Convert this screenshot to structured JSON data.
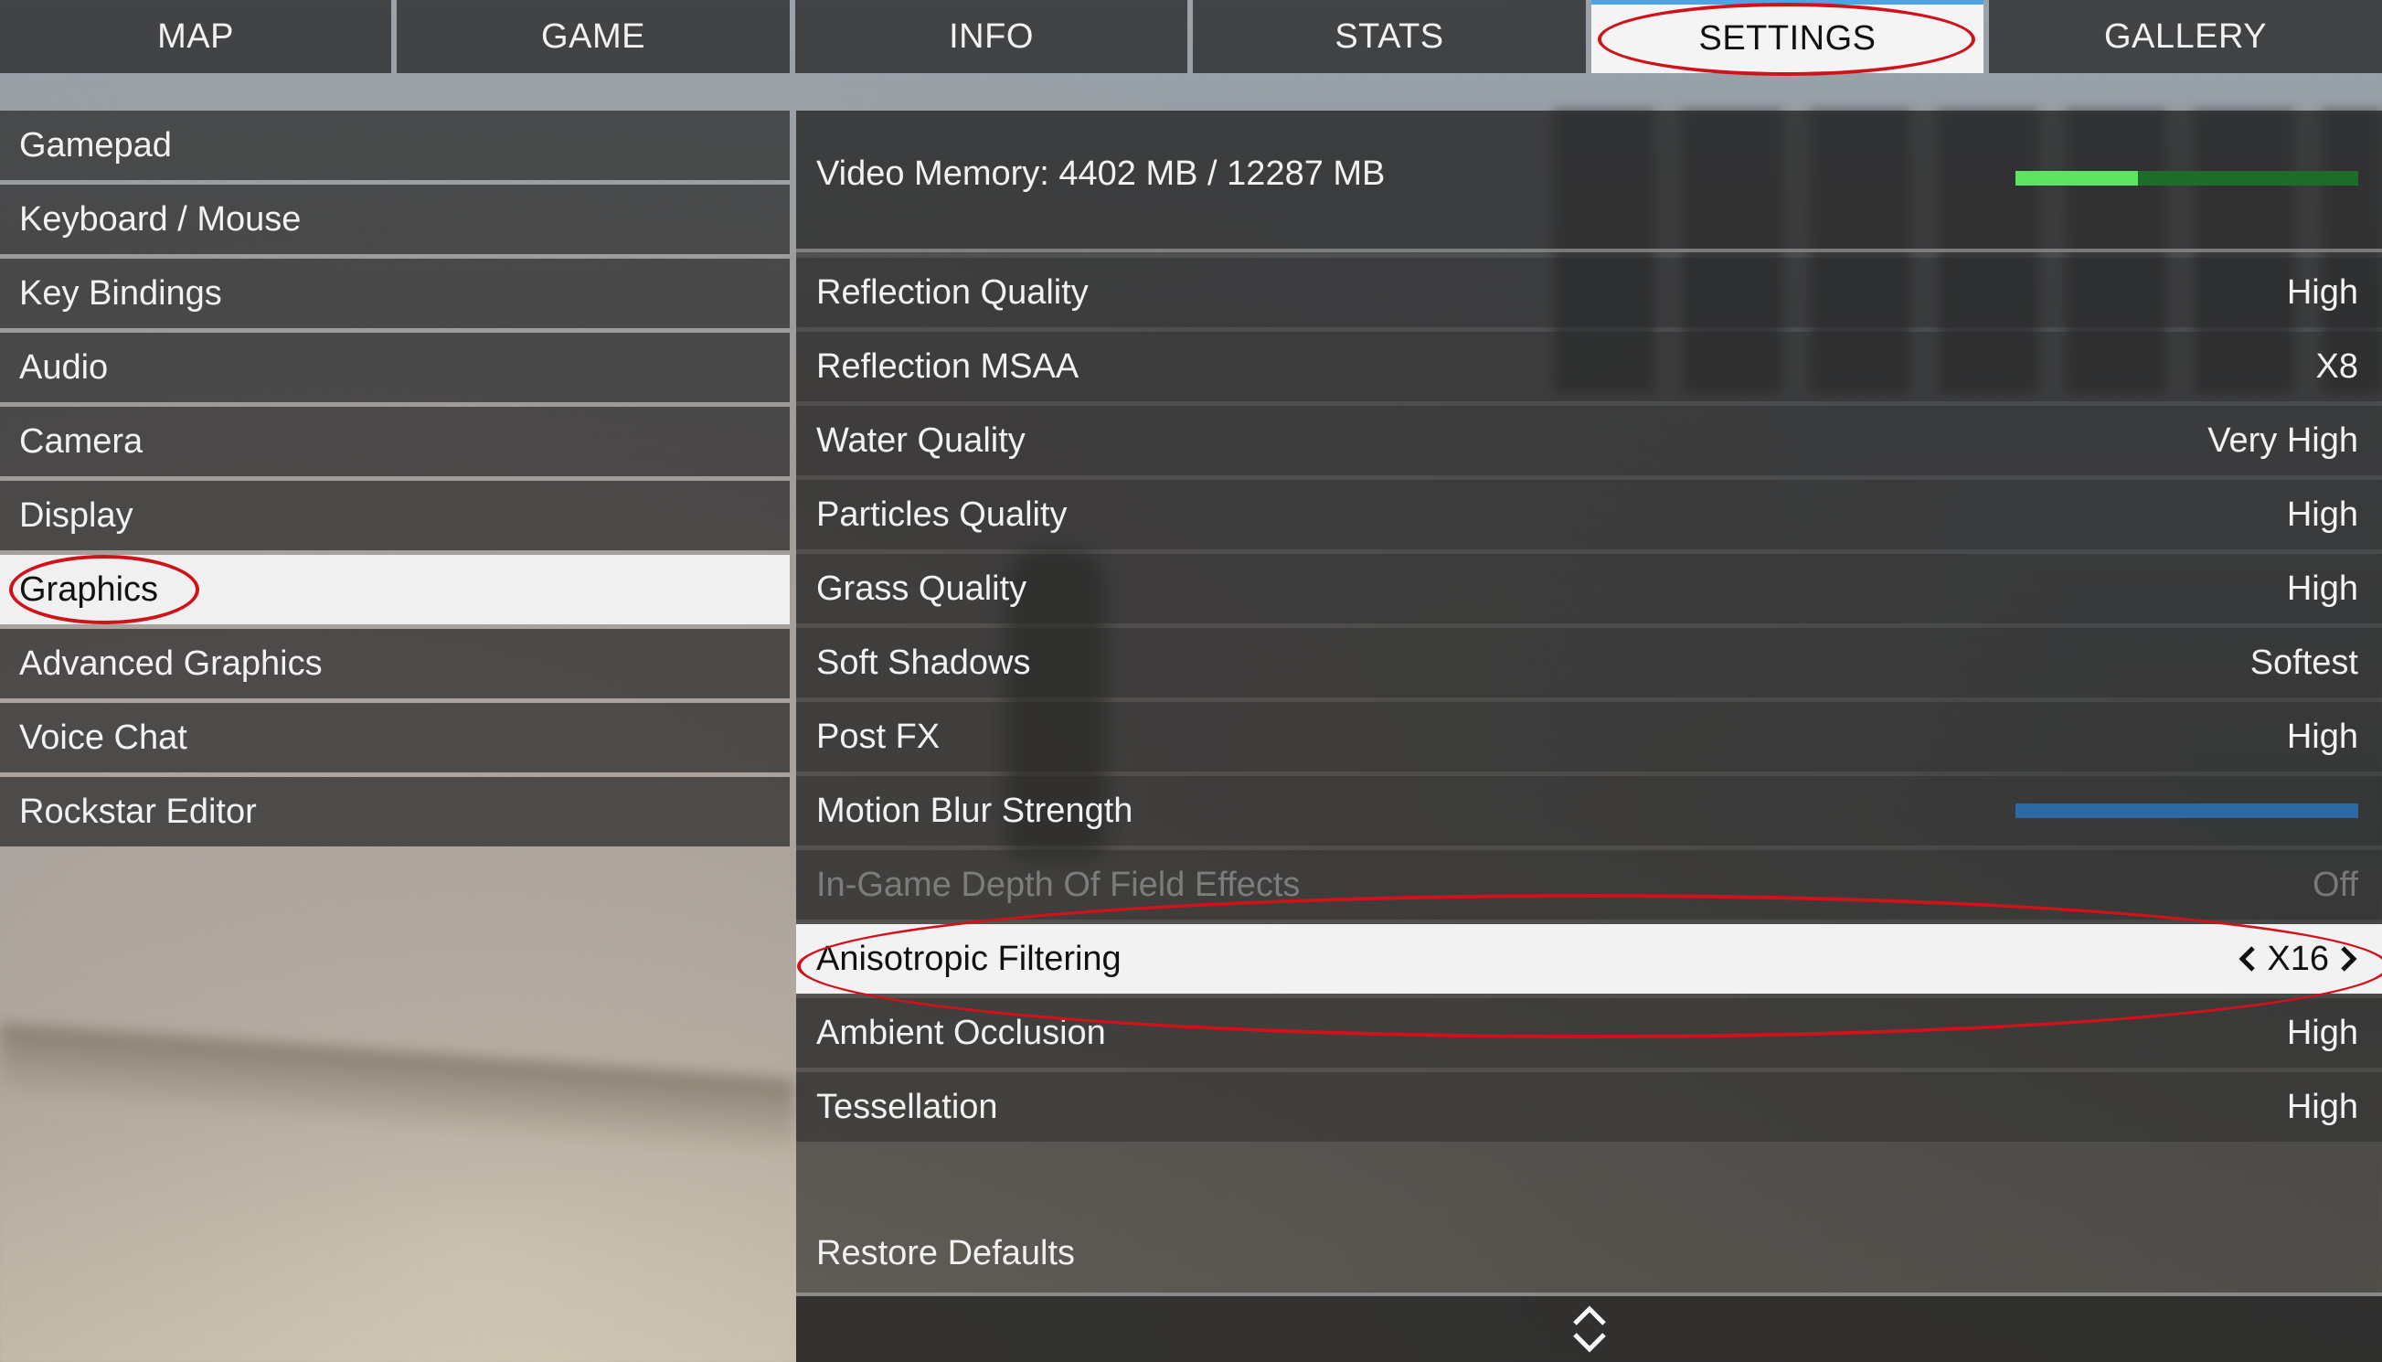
{
  "tabs": [
    {
      "label": "MAP"
    },
    {
      "label": "GAME"
    },
    {
      "label": "INFO"
    },
    {
      "label": "STATS"
    },
    {
      "label": "SETTINGS",
      "active": true
    },
    {
      "label": "GALLERY"
    }
  ],
  "menu": [
    {
      "label": "Gamepad"
    },
    {
      "label": "Keyboard / Mouse"
    },
    {
      "label": "Key Bindings"
    },
    {
      "label": "Audio"
    },
    {
      "label": "Camera"
    },
    {
      "label": "Display"
    },
    {
      "label": "Graphics",
      "selected": true
    },
    {
      "label": "Advanced Graphics"
    },
    {
      "label": "Voice Chat"
    },
    {
      "label": "Rockstar Editor"
    }
  ],
  "video_memory": {
    "label": "Video Memory: 4402 MB / 12287 MB",
    "used_mb": 4402,
    "total_mb": 12287,
    "used_fraction": 0.358
  },
  "settings": [
    {
      "label": "Reflection Quality",
      "value": "High"
    },
    {
      "label": "Reflection MSAA",
      "value": "X8"
    },
    {
      "label": "Water Quality",
      "value": "Very High"
    },
    {
      "label": "Particles Quality",
      "value": "High"
    },
    {
      "label": "Grass Quality",
      "value": "High"
    },
    {
      "label": "Soft Shadows",
      "value": "Softest"
    },
    {
      "label": "Post FX",
      "value": "High"
    },
    {
      "label": "Motion Blur Strength",
      "value": "",
      "slider_fraction": 1.0
    },
    {
      "label": "In-Game Depth Of Field Effects",
      "value": "Off",
      "disabled": true
    },
    {
      "label": "Anisotropic Filtering",
      "value": "X16",
      "selected": true
    },
    {
      "label": "Ambient Occlusion",
      "value": "High"
    },
    {
      "label": "Tessellation",
      "value": "High"
    }
  ],
  "restore_defaults": "Restore Defaults",
  "colors": {
    "accent_ring": "#d0121b",
    "tab_active_top": "#4fa2e4",
    "vram_fill": "#5ce564",
    "vram_track": "#1f6b2b",
    "slider": "#2d6aa4"
  }
}
